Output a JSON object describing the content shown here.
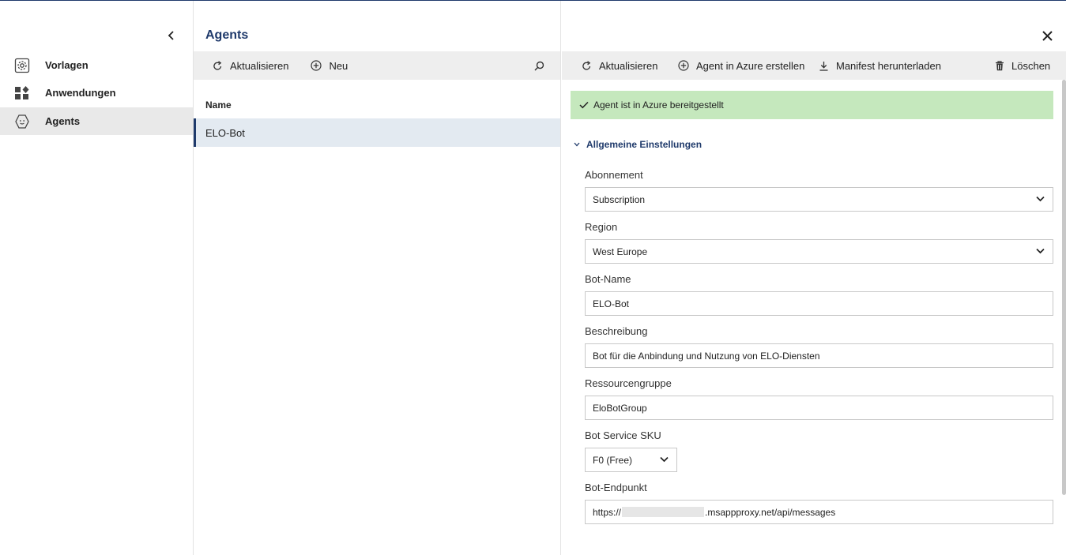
{
  "nav": {
    "items": [
      {
        "label": "Vorlagen",
        "icon": "templates-gear-icon"
      },
      {
        "label": "Anwendungen",
        "icon": "apps-grid-icon"
      },
      {
        "label": "Agents",
        "icon": "agent-bot-icon",
        "active": true
      }
    ]
  },
  "list": {
    "title": "Agents",
    "toolbar": {
      "refresh": "Aktualisieren",
      "new": "Neu"
    },
    "column": "Name",
    "rows": [
      "ELO-Bot"
    ]
  },
  "detail": {
    "toolbar": {
      "refresh": "Aktualisieren",
      "create": "Agent in Azure erstellen",
      "download": "Manifest herunterladen",
      "delete": "Löschen"
    },
    "banner": "Agent ist in Azure bereitgestellt",
    "section": "Allgemeine Einstellungen",
    "fields": {
      "subscription": {
        "label": "Abonnement",
        "value": "Subscription"
      },
      "region": {
        "label": "Region",
        "value": "West Europe"
      },
      "botname": {
        "label": "Bot-Name",
        "value": "ELO-Bot"
      },
      "description": {
        "label": "Beschreibung",
        "value": "Bot für die Anbindung und Nutzung von ELO-Diensten"
      },
      "resourcegroup": {
        "label": "Ressourcengruppe",
        "value": "EloBotGroup"
      },
      "sku": {
        "label": "Bot Service SKU",
        "value": "F0 (Free)"
      },
      "endpoint": {
        "label": "Bot-Endpunkt",
        "prefix": "https://",
        "suffix": ".msappproxy.net/api/messages"
      }
    }
  },
  "colors": {
    "accent": "#1f3a6b",
    "success_bg": "#c5e8bd",
    "selected_row": "#e3eaf1",
    "toolbar_bg": "#eeeeee"
  }
}
